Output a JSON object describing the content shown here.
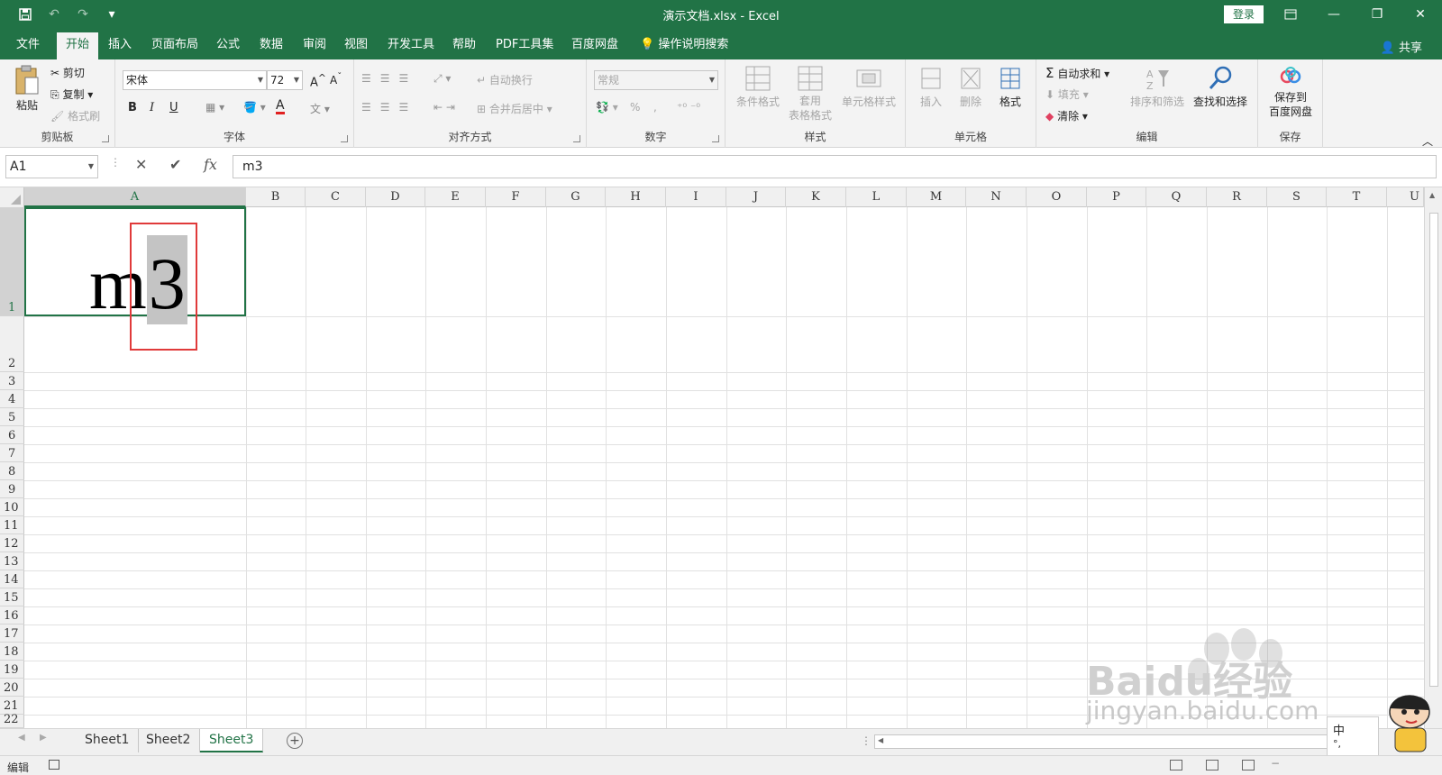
{
  "titlebar": {
    "title": "演示文档.xlsx  -  Excel",
    "login": "登录",
    "qat_more": "▾"
  },
  "tabs": [
    {
      "label": "文件"
    },
    {
      "label": "开始"
    },
    {
      "label": "插入"
    },
    {
      "label": "页面布局"
    },
    {
      "label": "公式"
    },
    {
      "label": "数据"
    },
    {
      "label": "审阅"
    },
    {
      "label": "视图"
    },
    {
      "label": "开发工具"
    },
    {
      "label": "帮助"
    },
    {
      "label": "PDF工具集"
    },
    {
      "label": "百度网盘"
    }
  ],
  "tell_me": "操作说明搜索",
  "share": "共享",
  "ribbon": {
    "clipboard": {
      "label": "剪贴板",
      "paste": "粘贴",
      "cut": "剪切",
      "copy": "复制",
      "format_painter": "格式刷"
    },
    "font": {
      "label": "字体",
      "font_name": "宋体",
      "font_size": "72",
      "bold": "B",
      "italic": "I",
      "underline": "U",
      "font_color": "A",
      "phonetic": "文"
    },
    "alignment": {
      "label": "对齐方式",
      "wrap_text": "自动换行",
      "merge_center": "合并后居中"
    },
    "number": {
      "label": "数字",
      "format": "常规",
      "percent": "%",
      "comma": ","
    },
    "styles": {
      "label": "样式",
      "conditional": "条件格式",
      "table_line1": "套用",
      "table_line2": "表格格式",
      "cell_styles": "单元格样式"
    },
    "cells": {
      "label": "单元格",
      "insert": "插入",
      "delete": "删除",
      "format": "格式"
    },
    "editing": {
      "label": "编辑",
      "autosum": "自动求和",
      "fill": "填充",
      "clear": "清除",
      "sort_filter": "排序和筛选",
      "find_select": "查找和选择"
    },
    "save": {
      "label": "保存",
      "save_line1": "保存到",
      "save_line2": "百度网盘"
    }
  },
  "formula_bar": {
    "name_box": "A1",
    "cancel": "✕",
    "enter": "✔",
    "fx": "fx",
    "content": "m3"
  },
  "grid": {
    "columns": [
      "A",
      "B",
      "C",
      "D",
      "E",
      "F",
      "G",
      "H",
      "I",
      "J",
      "K",
      "L",
      "M",
      "N",
      "O",
      "P",
      "Q",
      "R",
      "S",
      "T",
      "U"
    ],
    "rows": [
      "1",
      "2",
      "3",
      "4",
      "5",
      "6",
      "7",
      "8",
      "9",
      "10",
      "11",
      "12",
      "13",
      "14",
      "15",
      "16",
      "17",
      "18",
      "19",
      "20",
      "21",
      "22"
    ],
    "selected_column": "A",
    "selected_row": "1",
    "a1_prefix": "m",
    "a1_highlighted": "3"
  },
  "sheets": {
    "tabs": [
      "Sheet1",
      "Sheet2",
      "Sheet3"
    ],
    "active": "Sheet3",
    "add": "+"
  },
  "status": {
    "mode": "编辑"
  },
  "watermark": {
    "text": "jingyan.baidu.com",
    "brand": "Bai",
    "brand2": "du",
    "brand3": "经验"
  },
  "ime": {
    "lang": "中",
    "punct": "°,"
  }
}
